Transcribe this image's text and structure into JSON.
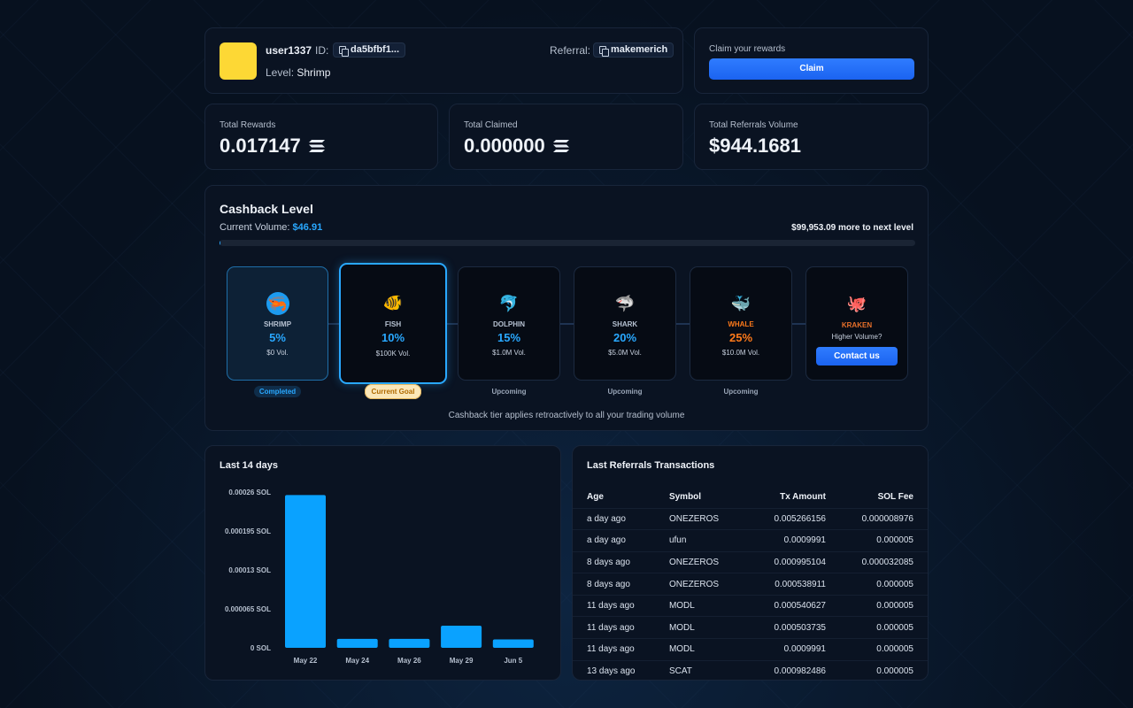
{
  "profile": {
    "username": "user1337",
    "id_label": "ID:",
    "id_value": "da5bfbf1...",
    "level_label": "Level:",
    "level_value": "Shrimp",
    "referral_label": "Referral:",
    "referral_code": "makemerich",
    "avatar_color": "#fdd835"
  },
  "claim": {
    "title": "Claim your rewards",
    "button": "Claim"
  },
  "stats": [
    {
      "label": "Total Rewards",
      "value": "0.017147",
      "icon": "solana-icon"
    },
    {
      "label": "Total Claimed",
      "value": "0.000000",
      "icon": "solana-icon"
    },
    {
      "label": "Total Referrals Volume",
      "value": "$944.1681",
      "icon": ""
    }
  ],
  "cashback": {
    "title": "Cashback Level",
    "current_volume_label": "Current Volume:",
    "current_volume": "$46.91",
    "next_level_text": "$99,953.09 more to next level",
    "progress_fraction": 0.0005,
    "footnote": "Cashback tier applies retroactively to all your trading volume",
    "tiers": [
      {
        "name": "SHRIMP",
        "pct": "5%",
        "vol": "$0 Vol.",
        "status": "Completed",
        "icon": "shrimp-icon",
        "glyph": "🦐"
      },
      {
        "name": "FISH",
        "pct": "10%",
        "vol": "$100K Vol.",
        "status": "Current Goal",
        "icon": "fish-icon",
        "glyph": "🐠"
      },
      {
        "name": "DOLPHIN",
        "pct": "15%",
        "vol": "$1.0M Vol.",
        "status": "Upcoming",
        "icon": "dolphin-icon",
        "glyph": "🐬"
      },
      {
        "name": "SHARK",
        "pct": "20%",
        "vol": "$5.0M Vol.",
        "status": "Upcoming",
        "icon": "shark-icon",
        "glyph": "🦈"
      },
      {
        "name": "WHALE",
        "pct": "25%",
        "vol": "$10.0M Vol.",
        "status": "Upcoming",
        "icon": "whale-icon",
        "glyph": "🐳"
      },
      {
        "name": "KRAKEN",
        "sub": "Higher Volume?",
        "button": "Contact us",
        "icon": "kraken-icon",
        "glyph": "🐙"
      }
    ],
    "accent": "#29a8ff",
    "whale_color": "#ff7a1a",
    "kraken_color": "#e8702a"
  },
  "chart_title": "Last 14 days",
  "chart_data": {
    "type": "bar",
    "categories": [
      "May 22",
      "May 24",
      "May 26",
      "May 29",
      "Jun 5"
    ],
    "values": [
      0.000255,
      1.5e-05,
      1.5e-05,
      3.7e-05,
      1.4e-05
    ],
    "ytick_labels": [
      "0.00026 SOL",
      "0.000195 SOL",
      "0.00013 SOL",
      "0.000065 SOL",
      "0 SOL"
    ],
    "yticks": [
      0.00026,
      0.000195,
      0.00013,
      6.5e-05,
      0
    ],
    "ylim": [
      0,
      0.00026
    ],
    "color": "#0aa2ff",
    "grid": false,
    "xlabel": "",
    "ylabel": ""
  },
  "transactions": {
    "title": "Last Referrals Transactions",
    "headers": [
      "Age",
      "Symbol",
      "Tx Amount",
      "SOL Fee"
    ],
    "rows": [
      [
        "a day ago",
        "ONEZEROS",
        "0.005266156",
        "0.000008976"
      ],
      [
        "a day ago",
        "ufun",
        "0.0009991",
        "0.000005"
      ],
      [
        "8 days ago",
        "ONEZEROS",
        "0.000995104",
        "0.000032085"
      ],
      [
        "8 days ago",
        "ONEZEROS",
        "0.000538911",
        "0.000005"
      ],
      [
        "11 days ago",
        "MODL",
        "0.000540627",
        "0.000005"
      ],
      [
        "11 days ago",
        "MODL",
        "0.000503735",
        "0.000005"
      ],
      [
        "11 days ago",
        "MODL",
        "0.0009991",
        "0.000005"
      ],
      [
        "13 days ago",
        "SCAT",
        "0.000982486",
        "0.000005"
      ]
    ]
  }
}
